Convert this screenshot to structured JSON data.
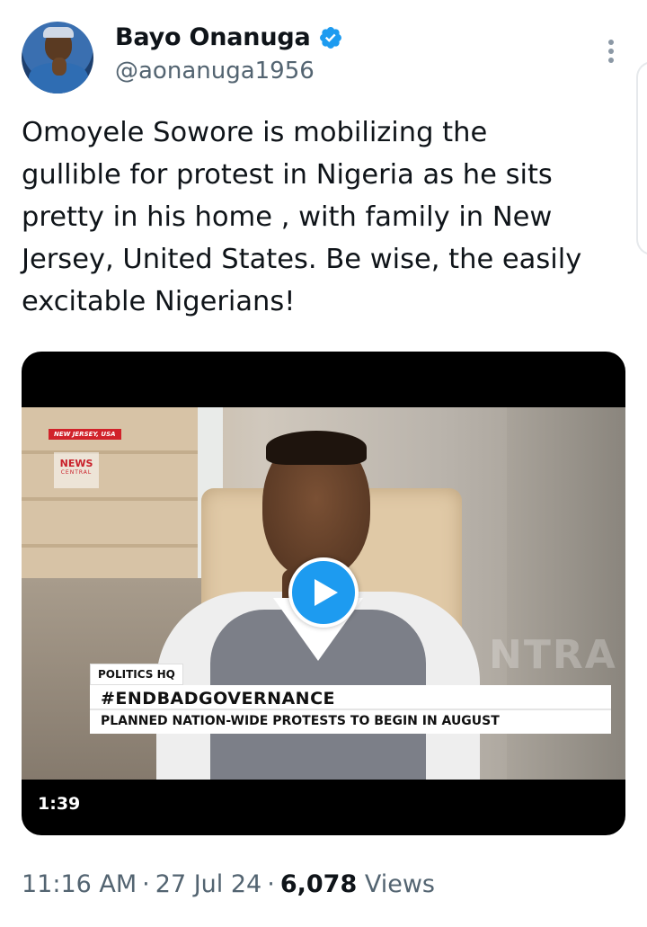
{
  "author": {
    "display_name": "Bayo Onanuga",
    "handle": "@aonanuga1956",
    "verified_icon": "verified-badge-icon",
    "verified_color": "#1d9bf0"
  },
  "tweet": {
    "text": "Omoyele Sowore is mobilizing the\ngullible for protest in Nigeria as he sits\npretty in his home , with family in New\nJersey, United States. Be wise, the easily\nexcitable Nigerians!"
  },
  "video": {
    "location_tag": "NEW JERSEY, USA",
    "logo_line1": "NEWS",
    "logo_line2": "CENTRAL",
    "lower_third_label": "POLITICS HQ",
    "headline": "#ENDBADGOVERNANCE",
    "subheadline": "PLANNED NATION-WIDE PROTESTS TO BEGIN IN AUGUST",
    "watermark_text": "NTRA",
    "duration": "1:39",
    "play_icon": "play-icon",
    "play_color": "#1d9bf0"
  },
  "meta": {
    "time": "11:16 AM",
    "separator": "·",
    "date": "27 Jul 24",
    "views_count": "6,078",
    "views_label": "Views"
  },
  "more_icon": "more-options-icon"
}
